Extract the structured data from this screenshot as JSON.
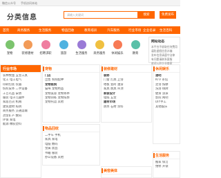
{
  "topbar": {
    "left": "微信公众号",
    "mid": "手机访问本站",
    "right": ""
  },
  "logo": "分类信息",
  "search": {
    "placeholder": "请输入关键词",
    "button": "搜索"
  },
  "post_button": "免费发布",
  "nav": [
    "首页",
    "商务服务",
    "生活服务",
    "物品回收",
    "教育培训",
    "汽车服务",
    "行业市场",
    "企业名录",
    "生活百科",
    "资讯"
  ],
  "categories": [
    {
      "label": "宠物",
      "color": "#7cc46e"
    },
    {
      "label": "装修建材",
      "color": "#f29b58"
    },
    {
      "label": "招聘求职",
      "color": "#ef7ea0"
    },
    {
      "label": "旅游",
      "color": "#4fb2e0"
    },
    {
      "label": "生活服务",
      "color": "#9a7ad6"
    },
    {
      "label": "商务服务",
      "color": "#f0c040"
    },
    {
      "label": "休闲娱乐",
      "color": "#f77a55"
    },
    {
      "label": "教育",
      "color": "#5ac0a8"
    }
  ],
  "notice": {
    "title": "网站动态",
    "lines": [
      "本平台不收取任何费用",
      "谨防虚假信息诈骗",
      "发布信息请遵守法律",
      "有问题请联系客服",
      "欢迎入驻企业商家"
    ]
  },
  "left_panel": {
    "title": "行业市场",
    "rows": [
      "农林牧渔  五金工具",
      "化工  电工电气",
      "印刷包装  仪器",
      "纺织皮革  二手设备",
      "工艺礼品  安防",
      "服装  电子元器件",
      "家居百货  机械",
      "建筑建材  照明",
      "商务服务  交通运输",
      "冶金矿产  数码",
      "环保  家电",
      "能源  橡胶塑料"
    ]
  },
  "panels": [
    {
      "title": "宠物",
      "rows": [
        "门店",
        "出售  狗狗配种",
        "宠物医院",
        "猫咪  宠物用品",
        "宠物美容  宠物寄养",
        "宠物训练  宠物殡葬",
        "宠物托运  其他"
      ]
    },
    {
      "title": "装修建材",
      "rows": [
        "装修",
        "门窗  灯具  卫浴",
        "地板  瓷砖  油漆",
        "家具  厨具  吊顶",
        "家装设计",
        "墙纸  五金",
        "建材市场",
        "防水  石材  涂料"
      ]
    },
    {
      "title": "休闲娱乐",
      "rows": [
        "酒吧",
        "KTV  茶馆",
        "足浴  按摩",
        "洗浴  棋牌",
        "健身  游泳",
        "影院  网吧",
        "DIY手工",
        "其他娱乐"
      ]
    },
    {
      "title": "物品回收",
      "rows": [
        "二手车  手机",
        "家具  家电",
        "电脑  数码",
        "金属  废品",
        "书籍  服装",
        "办公设备  其他"
      ]
    },
    {
      "title": "美容美体",
      "rows": [
        "美发  美甲",
        "化妆  纹身"
      ]
    },
    {
      "title": "生活服务",
      "rows": [
        "搬家  保洁",
        "维修  开锁"
      ]
    }
  ]
}
